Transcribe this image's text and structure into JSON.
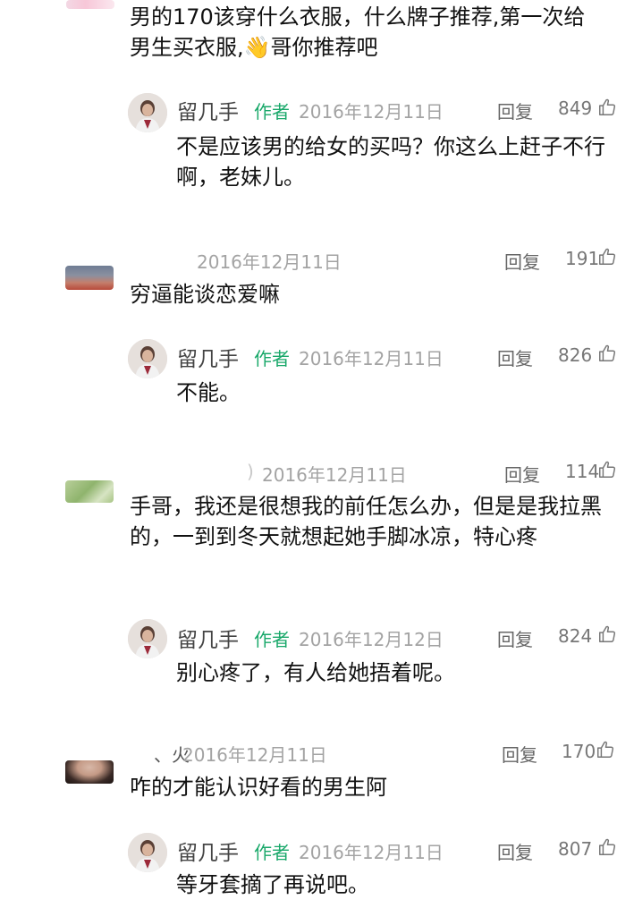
{
  "comments": [
    {
      "text": "男的170该穿什么衣服，什么牌子推荐,第一次给男生买衣服,👋哥你推荐吧",
      "reply": {
        "name": "留几手",
        "tag": "作者",
        "date": "2016年12月11日",
        "reply_label": "回复",
        "likes": "849",
        "text": "不是应该男的给女的买吗？你这么上赶子不行啊，老妹儿。"
      }
    },
    {
      "date": "2016年12月11日",
      "reply_label": "回复",
      "likes": "191",
      "text": "穷逼能谈恋爱嘛",
      "reply": {
        "name": "留几手",
        "tag": "作者",
        "date": "2016年12月11日",
        "reply_label": "回复",
        "likes": "826",
        "text": "不能。"
      }
    },
    {
      "name_fragment": ")",
      "date": "2016年12月11日",
      "reply_label": "回复",
      "likes": "114",
      "text": "手哥，我还是很想我的前任怎么办，但是是我拉黑的，一到到冬天就想起她手脚冰凉，特心疼",
      "reply": {
        "name": "留几手",
        "tag": "作者",
        "date": "2016年12月12日",
        "reply_label": "回复",
        "likes": "824",
        "text": "别心疼了，有人给她捂着呢。"
      }
    },
    {
      "name_fragment": "、火",
      "date": "2016年12月11日",
      "reply_label": "回复",
      "likes": "170",
      "text": "咋的才能认识好看的男生阿",
      "reply": {
        "name": "留几手",
        "tag": "作者",
        "date": "2016年12月11日",
        "reply_label": "回复",
        "likes": "807",
        "text": "等牙套摘了再说吧。"
      }
    }
  ],
  "colors": {
    "author_tag": "#19a86a",
    "date": "#a3a3a3"
  },
  "icons": {
    "like": "thumbs-up-icon"
  }
}
